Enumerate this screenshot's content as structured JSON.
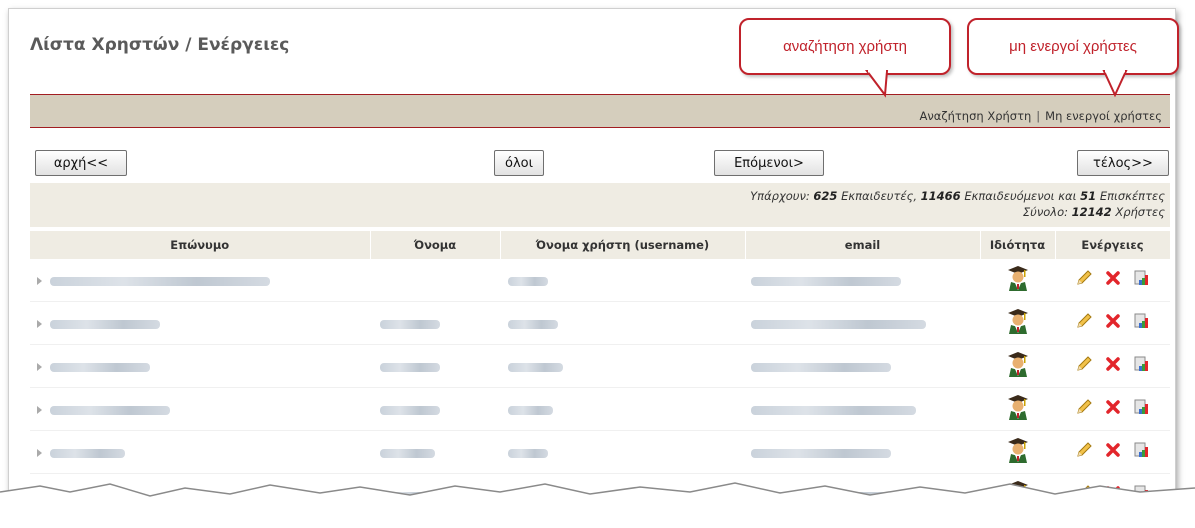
{
  "page": {
    "title": "Λίστα Χρηστών / Ενέργειες"
  },
  "links": {
    "search_user": "Αναζήτηση Χρήστη",
    "separator": "|",
    "inactive_users": "Μη ενεργοί χρήστες"
  },
  "pager": {
    "first": "αρχή<<",
    "all": "όλοι",
    "next": "Επόμενοι>",
    "last": "τέλος>>"
  },
  "stats": {
    "line1_prefix": "Υπάρχουν:",
    "teachers_count": "625",
    "teachers_label": "Εκπαιδευτές,",
    "students_count": "11466",
    "students_label": "Εκπαιδευόμενοι και",
    "guests_count": "51",
    "guests_label": "Επισκέπτες",
    "total_prefix": "Σύνολο:",
    "total_count": "12142",
    "total_label": "Χρήστες"
  },
  "table": {
    "columns": [
      "Επώνυμο",
      "Όνομα",
      "Όνομα χρήστη (username)",
      "email",
      "Ιδιότητα",
      "Ενέργειες"
    ],
    "rows": [
      {
        "role_icon": "teacher-icon",
        "actions": [
          "edit-pencil-icon",
          "delete-x-icon",
          "stats-icon"
        ]
      },
      {
        "role_icon": "teacher-icon",
        "actions": [
          "edit-pencil-icon",
          "delete-x-icon",
          "stats-icon"
        ]
      },
      {
        "role_icon": "teacher-icon",
        "actions": [
          "edit-pencil-icon",
          "delete-x-icon",
          "stats-icon"
        ]
      },
      {
        "role_icon": "teacher-icon",
        "actions": [
          "edit-pencil-icon",
          "delete-x-icon",
          "stats-icon"
        ]
      },
      {
        "role_icon": "teacher-icon",
        "actions": [
          "edit-pencil-icon",
          "delete-x-icon",
          "stats-icon"
        ]
      },
      {
        "role_icon": "teacher-icon",
        "actions": [
          "edit-pencil-icon",
          "delete-x-icon",
          "stats-icon"
        ]
      }
    ]
  },
  "callouts": {
    "search": "αναζήτηση χρήστη",
    "inactive": "μη ενεργοί χρήστες"
  },
  "colors": {
    "accent_red": "#c0222b",
    "header_bar": "#d5cebd",
    "stats_bg": "#efece3"
  }
}
